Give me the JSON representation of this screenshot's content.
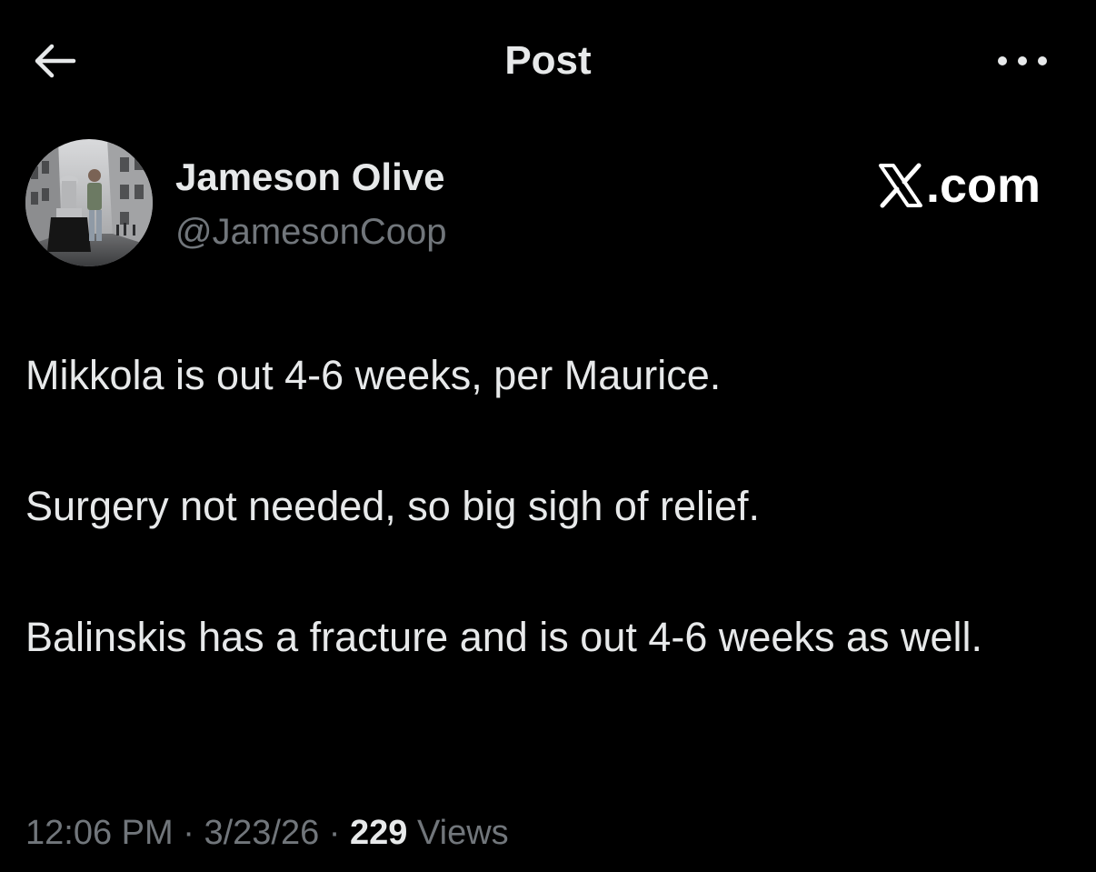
{
  "header": {
    "title": "Post",
    "back_icon": "arrow-left-icon",
    "more_icon": "more-horizontal-icon"
  },
  "author": {
    "display_name": "Jameson Olive",
    "handle": "@JamesonCoop",
    "avatar_icon": "avatar-photo"
  },
  "brand": {
    "logo_icon": "x-logo-icon",
    "text": ".com"
  },
  "post": {
    "paragraphs": [
      "Mikkola is out 4-6 weeks, per Maurice.",
      "Surgery not needed, so big sigh of relief.",
      "Balinskis has a fracture and is out 4-6 weeks as well."
    ]
  },
  "meta": {
    "time": "12:06 PM",
    "separator": " · ",
    "date": "3/23/26",
    "views_count": "229",
    "views_label": " Views"
  },
  "colors": {
    "background": "#000000",
    "primary_text": "#e7e9ea",
    "secondary_text": "#71767b"
  }
}
